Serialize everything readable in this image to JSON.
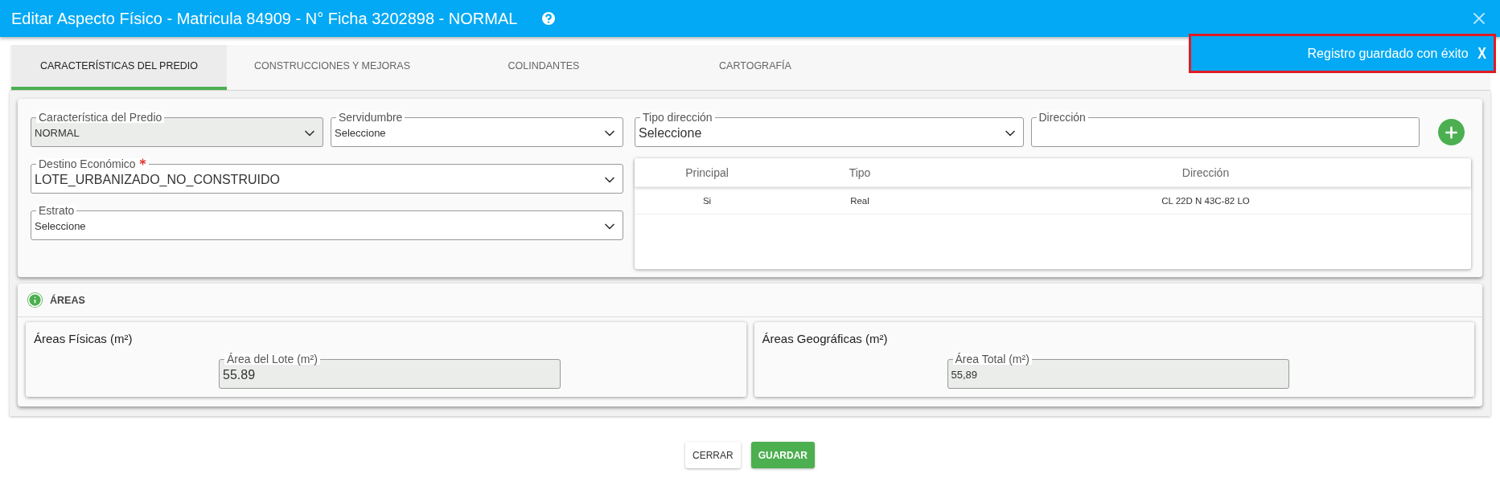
{
  "window": {
    "title": "Editar Aspecto Físico - Matricula 84909 - N° Ficha 3202898 - NORMAL"
  },
  "toast": {
    "message": "Registro guardado con éxito",
    "close": "X"
  },
  "tabs": [
    {
      "label": "CARACTERÍSTICAS DEL PREDIO",
      "selected": true
    },
    {
      "label": "CONSTRUCCIONES Y MEJORAS",
      "selected": false
    },
    {
      "label": "COLINDANTES",
      "selected": false
    },
    {
      "label": "CARTOGRAFÍA",
      "selected": false
    }
  ],
  "predio_fields": [
    {
      "kind": "select",
      "label": "Característica del Predio",
      "value": "NORMAL",
      "required": false,
      "disabled": true
    },
    {
      "kind": "select",
      "label": "Servidumbre",
      "value": "Seleccione",
      "required": false,
      "disabled": false
    },
    {
      "kind": "select",
      "label": "Destino Económico",
      "value": "LOTE_URBANIZADO_NO_CONSTRUIDO",
      "required": true,
      "disabled": false
    },
    {
      "kind": "select",
      "label": "Estrato",
      "value": "Seleccione",
      "required": false,
      "disabled": false
    }
  ],
  "direccion_fields": [
    {
      "kind": "select",
      "label": "Tipo dirección",
      "value": "Seleccione",
      "required": false,
      "disabled": false
    },
    {
      "kind": "text",
      "label": "Dirección",
      "required": false,
      "disabled": false
    }
  ],
  "direccion_table": {
    "columns": [
      "Principal",
      "Tipo",
      "Dirección"
    ],
    "rows": [
      [
        "Si",
        "Real",
        "CL 22D N 43C-82 LO"
      ]
    ]
  },
  "areas": {
    "title": "ÁREAS",
    "cards": [
      {
        "title": "Áreas Físicas (m²)",
        "field": {
          "label": "Área del Lote (m²)",
          "value": "55.89"
        }
      },
      {
        "title": "Áreas Geográficas (m²)",
        "field": {
          "label": "Área Total (m²)",
          "value": "55,89"
        }
      }
    ]
  },
  "buttons": [
    {
      "label": "CERRAR",
      "kind": "default"
    },
    {
      "label": "GUARDAR",
      "kind": "primary"
    }
  ]
}
